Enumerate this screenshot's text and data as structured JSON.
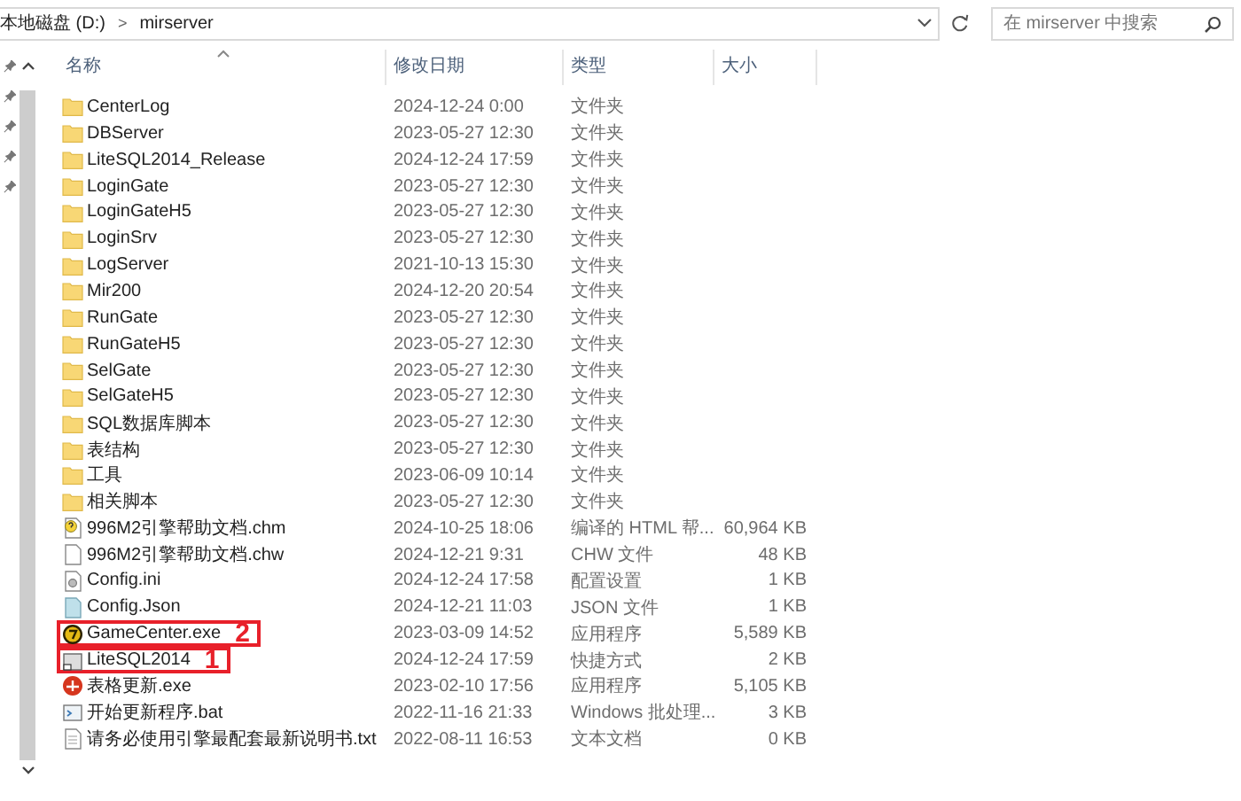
{
  "address_bar": {
    "crumbs": [
      "本地磁盘 (D:)",
      "mirserver"
    ],
    "separator": ">"
  },
  "search": {
    "placeholder": "在 mirserver 中搜索"
  },
  "columns": [
    "名称",
    "修改日期",
    "类型",
    "大小"
  ],
  "files": [
    {
      "kind": "folder",
      "name": "CenterLog",
      "date": "2024-12-24 0:00",
      "type": "文件夹"
    },
    {
      "kind": "folder",
      "name": "DBServer",
      "date": "2023-05-27 12:30",
      "type": "文件夹"
    },
    {
      "kind": "folder",
      "name": "LiteSQL2014_Release",
      "date": "2024-12-24 17:59",
      "type": "文件夹"
    },
    {
      "kind": "folder",
      "name": "LoginGate",
      "date": "2023-05-27 12:30",
      "type": "文件夹"
    },
    {
      "kind": "folder",
      "name": "LoginGateH5",
      "date": "2023-05-27 12:30",
      "type": "文件夹"
    },
    {
      "kind": "folder",
      "name": "LoginSrv",
      "date": "2023-05-27 12:30",
      "type": "文件夹"
    },
    {
      "kind": "folder",
      "name": "LogServer",
      "date": "2021-10-13 15:30",
      "type": "文件夹"
    },
    {
      "kind": "folder",
      "name": "Mir200",
      "date": "2024-12-20 20:54",
      "type": "文件夹"
    },
    {
      "kind": "folder",
      "name": "RunGate",
      "date": "2023-05-27 12:30",
      "type": "文件夹"
    },
    {
      "kind": "folder",
      "name": "RunGateH5",
      "date": "2023-05-27 12:30",
      "type": "文件夹"
    },
    {
      "kind": "folder",
      "name": "SelGate",
      "date": "2023-05-27 12:30",
      "type": "文件夹"
    },
    {
      "kind": "folder",
      "name": "SelGateH5",
      "date": "2023-05-27 12:30",
      "type": "文件夹"
    },
    {
      "kind": "folder",
      "name": "SQL数据库脚本",
      "date": "2023-05-27 12:30",
      "type": "文件夹"
    },
    {
      "kind": "folder",
      "name": "表结构",
      "date": "2023-05-27 12:30",
      "type": "文件夹"
    },
    {
      "kind": "folder",
      "name": "工具",
      "date": "2023-06-09 10:14",
      "type": "文件夹"
    },
    {
      "kind": "folder",
      "name": "相关脚本",
      "date": "2023-05-27 12:30",
      "type": "文件夹"
    },
    {
      "kind": "help",
      "name": "996M2引擎帮助文档.chm",
      "date": "2024-10-25 18:06",
      "type": "编译的 HTML 帮...",
      "size": "60,964 KB"
    },
    {
      "kind": "blank",
      "name": "996M2引擎帮助文档.chw",
      "date": "2024-12-21 9:31",
      "type": "CHW 文件",
      "size": "48 KB"
    },
    {
      "kind": "settings",
      "name": "Config.ini",
      "date": "2024-12-24 17:58",
      "type": "配置设置",
      "size": "1 KB"
    },
    {
      "kind": "json",
      "name": "Config.Json",
      "date": "2024-12-21 11:03",
      "type": "JSON 文件",
      "size": "1 KB"
    },
    {
      "kind": "game",
      "name": "GameCenter.exe",
      "date": "2023-03-09 14:52",
      "type": "应用程序",
      "size": "5,589 KB",
      "callout": "2"
    },
    {
      "kind": "shortcut",
      "name": "LiteSQL2014",
      "date": "2024-12-24 17:59",
      "type": "快捷方式",
      "size": "2 KB",
      "callout": "1"
    },
    {
      "kind": "update",
      "name": "表格更新.exe",
      "date": "2023-02-10 17:56",
      "type": "应用程序",
      "size": "5,105 KB"
    },
    {
      "kind": "batch",
      "name": "开始更新程序.bat",
      "date": "2022-11-16 21:33",
      "type": "Windows 批处理...",
      "size": "3 KB"
    },
    {
      "kind": "text",
      "name": "请务必使用引擎最配套最新说明书.txt",
      "date": "2022-08-11 16:53",
      "type": "文本文档",
      "size": "0 KB"
    }
  ]
}
